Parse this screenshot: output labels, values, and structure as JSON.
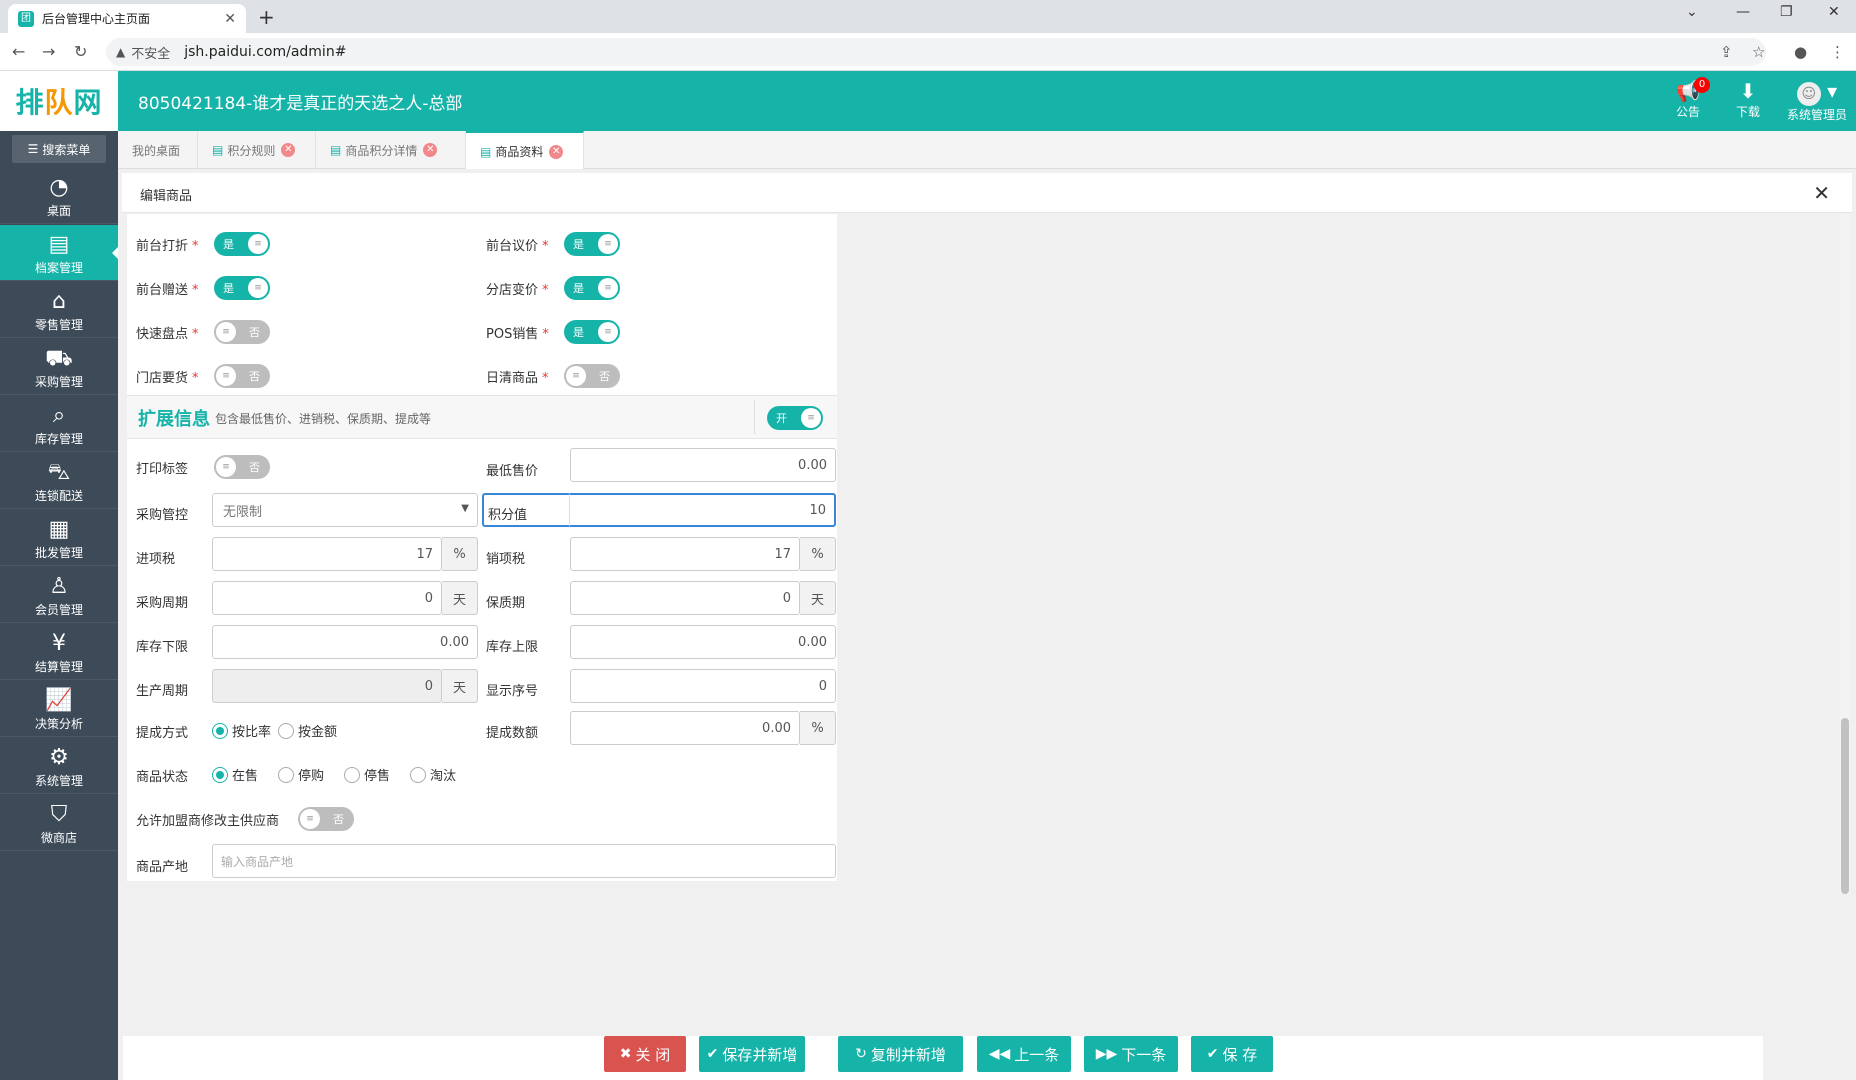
{
  "browser": {
    "tab_title": "后台管理中心主页面",
    "favicon_text": "团",
    "insecure_label": "不安全",
    "url": "jsh.paidui.com/admin#"
  },
  "header": {
    "logo_text_a": "排",
    "logo_text_b": "队",
    "logo_text_c": "网",
    "store_title": "8050421184-谁才是真正的天选之人-总部",
    "notice_label": "公告",
    "notice_count": "0",
    "download_label": "下载",
    "user_label": "系统管理员"
  },
  "sidebar": {
    "search_label": "搜索菜单",
    "items": [
      {
        "label": "桌面"
      },
      {
        "label": "档案管理"
      },
      {
        "label": "零售管理"
      },
      {
        "label": "采购管理"
      },
      {
        "label": "库存管理"
      },
      {
        "label": "连锁配送"
      },
      {
        "label": "批发管理"
      },
      {
        "label": "会员管理"
      },
      {
        "label": "结算管理"
      },
      {
        "label": "决策分析"
      },
      {
        "label": "系统管理"
      },
      {
        "label": "微商店"
      }
    ]
  },
  "tabs": [
    {
      "label": "我的桌面"
    },
    {
      "label": "积分规则"
    },
    {
      "label": "商品积分详情"
    },
    {
      "label": "商品资料"
    }
  ],
  "editor": {
    "title": "编辑商品",
    "switches": {
      "front_discount": {
        "label": "前台打折",
        "state": "是"
      },
      "front_bargain": {
        "label": "前台议价",
        "state": "是"
      },
      "front_gift": {
        "label": "前台赠送",
        "state": "是"
      },
      "branch_price": {
        "label": "分店变价",
        "state": "是"
      },
      "quick_stock": {
        "label": "快速盘点",
        "state": "否"
      },
      "pos_sale": {
        "label": "POS销售",
        "state": "是"
      },
      "store_order": {
        "label": "门店要货",
        "state": "否"
      },
      "daily_clear": {
        "label": "日清商品",
        "state": "否"
      }
    },
    "ext": {
      "title": "扩展信息",
      "desc": "包含最低售价、进销税、保质期、提成等",
      "switch_state": "开"
    },
    "fields": {
      "print_label": {
        "label": "打印标签",
        "state": "否"
      },
      "min_price": {
        "label": "最低售价",
        "value": "0.00"
      },
      "purchase_ctrl": {
        "label": "采购管控",
        "value": "无限制"
      },
      "points": {
        "label": "积分值",
        "value": "10"
      },
      "input_tax": {
        "label": "进项税",
        "value": "17",
        "unit": "%"
      },
      "output_tax": {
        "label": "销项税",
        "value": "17",
        "unit": "%"
      },
      "purchase_cycle": {
        "label": "采购周期",
        "value": "0",
        "unit": "天"
      },
      "shelf_life": {
        "label": "保质期",
        "value": "0",
        "unit": "天"
      },
      "stock_min": {
        "label": "库存下限",
        "value": "0.00"
      },
      "stock_max": {
        "label": "库存上限",
        "value": "0.00"
      },
      "prod_cycle": {
        "label": "生产周期",
        "value": "0",
        "unit": "天"
      },
      "display_order": {
        "label": "显示序号",
        "value": "0"
      },
      "commission_mode": {
        "label": "提成方式",
        "options": [
          "按比率",
          "按金额"
        ],
        "selected": "按比率"
      },
      "commission_value": {
        "label": "提成数额",
        "value": "0.00",
        "unit": "%"
      },
      "status": {
        "label": "商品状态",
        "options": [
          "在售",
          "停购",
          "停售",
          "淘汰"
        ],
        "selected": "在售"
      },
      "allow_supplier": {
        "label": "允许加盟商修改主供应商",
        "state": "否"
      },
      "origin": {
        "label": "商品产地",
        "placeholder": "输入商品产地"
      }
    }
  },
  "footer": {
    "close": "关 闭",
    "save_new": "保存并新增",
    "copy_new": "复制并新增",
    "prev": "上一条",
    "next": "下一条",
    "save": "保 存"
  }
}
